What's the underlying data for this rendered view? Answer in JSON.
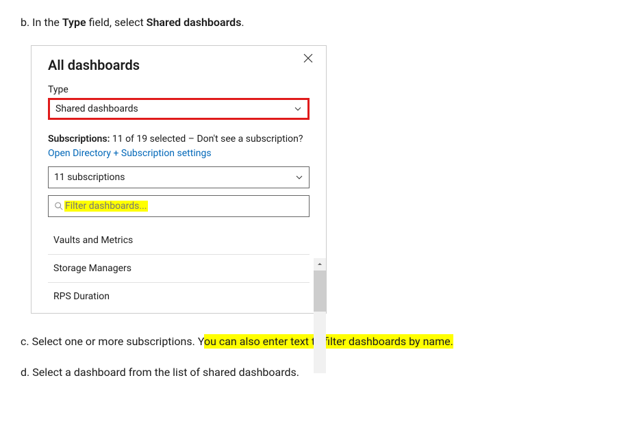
{
  "step_b": {
    "letter": "b.",
    "pre": "In the ",
    "bold1": "Type",
    "mid": " field, select ",
    "bold2": "Shared dashboards",
    "post": "."
  },
  "dialog": {
    "title": "All dashboards",
    "type_label": "Type",
    "type_value": "Shared dashboards",
    "subs_prefix_bold": "Subscriptions:",
    "subs_count": " 11 of 19 selected",
    "subs_mid": " – Don't see a subscription? ",
    "subs_link": "Open Directory + Subscription settings",
    "subs_dropdown_value": "11 subscriptions",
    "filter_placeholder": "Filter dashboards...",
    "items": [
      "Vaults and Metrics",
      "Storage Managers",
      "RPS Duration"
    ]
  },
  "step_c": {
    "letter": "c.",
    "text_plain": "Select one or more subscriptions. Y",
    "text_highlight": "ou can also enter text to filter dashboards by name."
  },
  "step_d": {
    "letter": "d.",
    "text": "Select a dashboard from the list of shared dashboards."
  }
}
